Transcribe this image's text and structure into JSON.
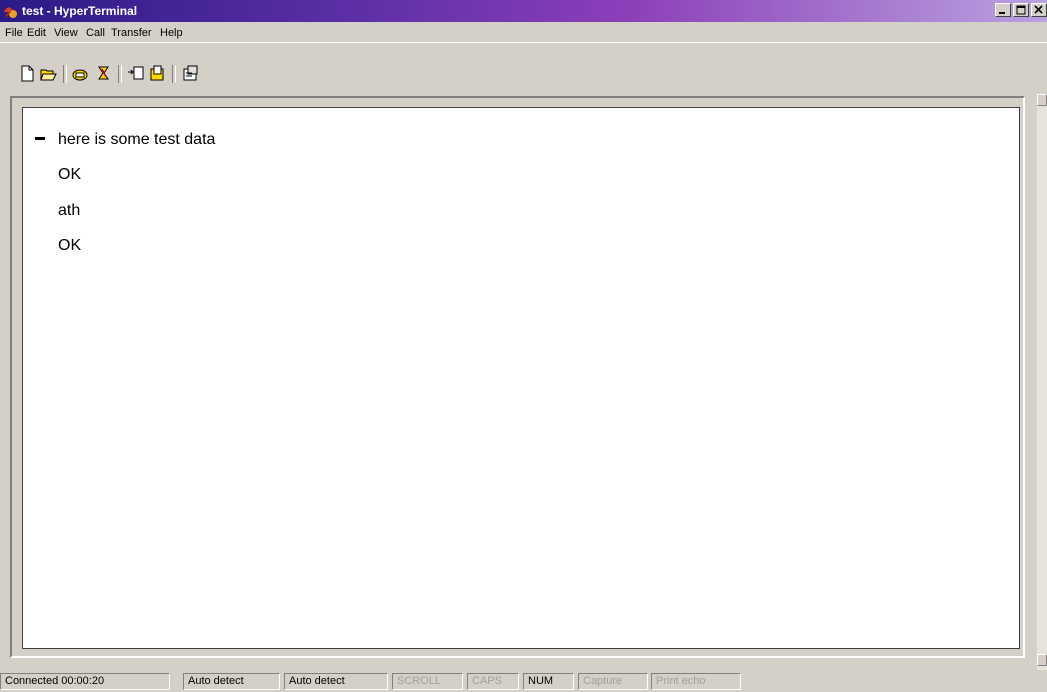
{
  "window": {
    "title": "test - HyperTerminal",
    "title_gradient_start": "#2a1a86",
    "title_gradient_end": "#b9a2e0"
  },
  "window_buttons": {
    "minimize": "minimize",
    "maximize": "maximize",
    "close": "close"
  },
  "menu": {
    "items": [
      "File",
      "Edit",
      "View",
      "Call",
      "Transfer",
      "Help"
    ]
  },
  "toolbar": {
    "buttons": [
      "new-icon",
      "open-icon",
      "connect-icon",
      "disconnect-icon",
      "send-icon",
      "receive-icon",
      "properties-icon"
    ]
  },
  "terminal": {
    "lines": [
      "here is some test data",
      "OK",
      "ath",
      "OK"
    ]
  },
  "status": {
    "connected": "Connected 00:00:20",
    "detect1": "Auto detect",
    "detect2": "Auto detect",
    "scroll": "SCROLL",
    "caps": "CAPS",
    "num": "NUM",
    "capture": "Capture",
    "print_echo": "Print echo"
  }
}
